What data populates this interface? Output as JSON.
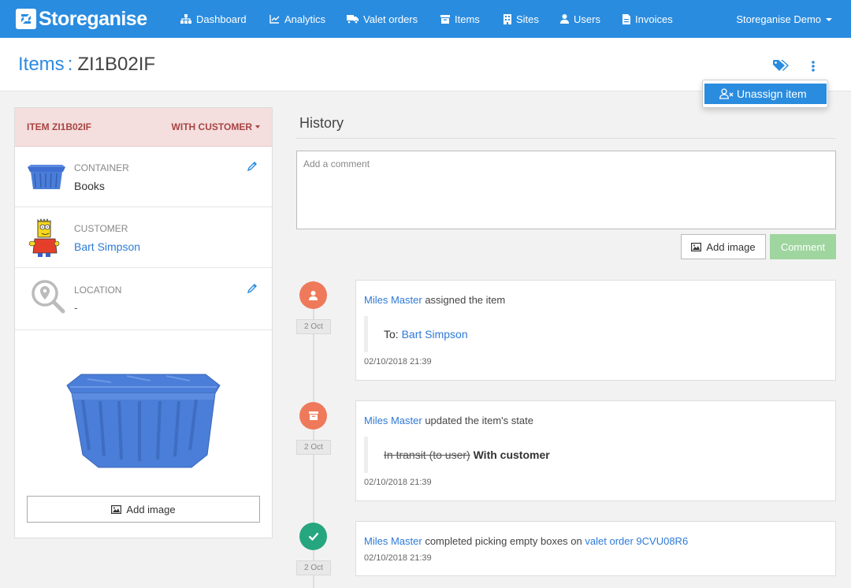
{
  "nav": {
    "brand": "Storeganise",
    "items": [
      {
        "label": "Dashboard",
        "icon": "dashboard-icon"
      },
      {
        "label": "Analytics",
        "icon": "analytics-icon"
      },
      {
        "label": "Valet orders",
        "icon": "truck-icon"
      },
      {
        "label": "Items",
        "icon": "archive-box-icon"
      },
      {
        "label": "Sites",
        "icon": "building-icon"
      },
      {
        "label": "Users",
        "icon": "user-icon"
      },
      {
        "label": "Invoices",
        "icon": "invoice-icon"
      }
    ],
    "account": "Storeganise Demo"
  },
  "header": {
    "section": "Items",
    "separator": ":",
    "item_code": "ZI1B02IF"
  },
  "menu": {
    "unassign_label": "Unassign item"
  },
  "item_card": {
    "id_label": "ITEM ZI1B02IF",
    "status": "WITH CUSTOMER",
    "container": {
      "label": "CONTAINER",
      "value": "Books"
    },
    "customer": {
      "label": "CUSTOMER",
      "value": "Bart Simpson"
    },
    "location": {
      "label": "LOCATION",
      "value": "-"
    },
    "add_image": "Add image"
  },
  "history": {
    "title": "History",
    "comment_placeholder": "Add a comment",
    "add_image_button": "Add image",
    "comment_button": "Comment",
    "events": [
      {
        "date": "2 Oct",
        "actor": "Miles Master",
        "action": "assigned the item",
        "to_label": "To:",
        "to_value": "Bart Simpson",
        "timestamp": "02/10/2018 21:39",
        "icon": "user-icon",
        "color": "#ee7a5b"
      },
      {
        "date": "2 Oct",
        "actor": "Miles Master",
        "action": "updated the item's state",
        "old_state": "In transit (to user)",
        "new_state": "With customer",
        "timestamp": "02/10/2018 21:39",
        "icon": "archive-box-icon",
        "color": "#ee7a5b"
      },
      {
        "date": "2 Oct",
        "actor": "Miles Master",
        "action": "completed picking empty boxes on",
        "link_text": "valet order 9CVU08R6",
        "timestamp": "02/10/2018 21:39",
        "icon": "check-icon",
        "color": "#26a67e"
      }
    ]
  },
  "colors": {
    "nav_bg": "#2a8cdf",
    "accent_link": "#2e7ad6",
    "status_danger_bg": "#f4dede",
    "status_danger_text": "#a94442",
    "comment_button_bg": "#9fd59f"
  }
}
